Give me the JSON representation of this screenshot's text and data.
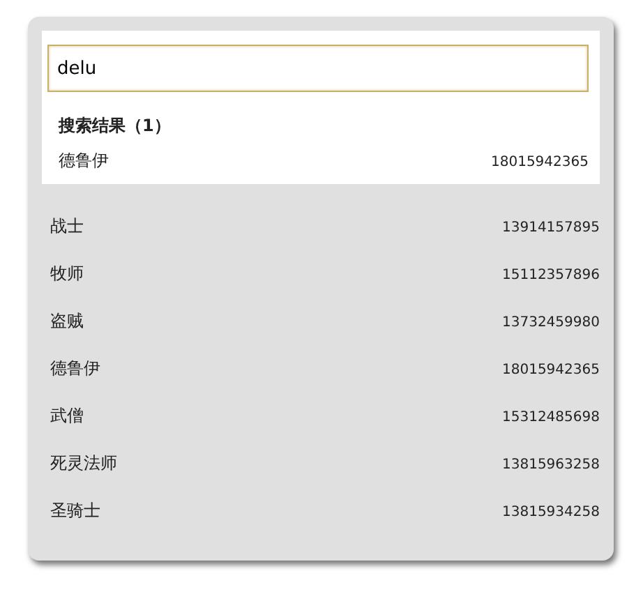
{
  "search": {
    "value": "delu"
  },
  "results": {
    "heading": "搜索结果（1）",
    "items": [
      {
        "name": "德鲁伊",
        "phone": "18015942365"
      }
    ]
  },
  "contacts": [
    {
      "name": "战士",
      "phone": "13914157895"
    },
    {
      "name": "牧师",
      "phone": "15112357896"
    },
    {
      "name": "盗贼",
      "phone": "13732459980"
    },
    {
      "name": "德鲁伊",
      "phone": "18015942365"
    },
    {
      "name": "武僧",
      "phone": "15312485698"
    },
    {
      "name": "死灵法师",
      "phone": "13815963258"
    },
    {
      "name": "圣骑士",
      "phone": "13815934258"
    }
  ]
}
